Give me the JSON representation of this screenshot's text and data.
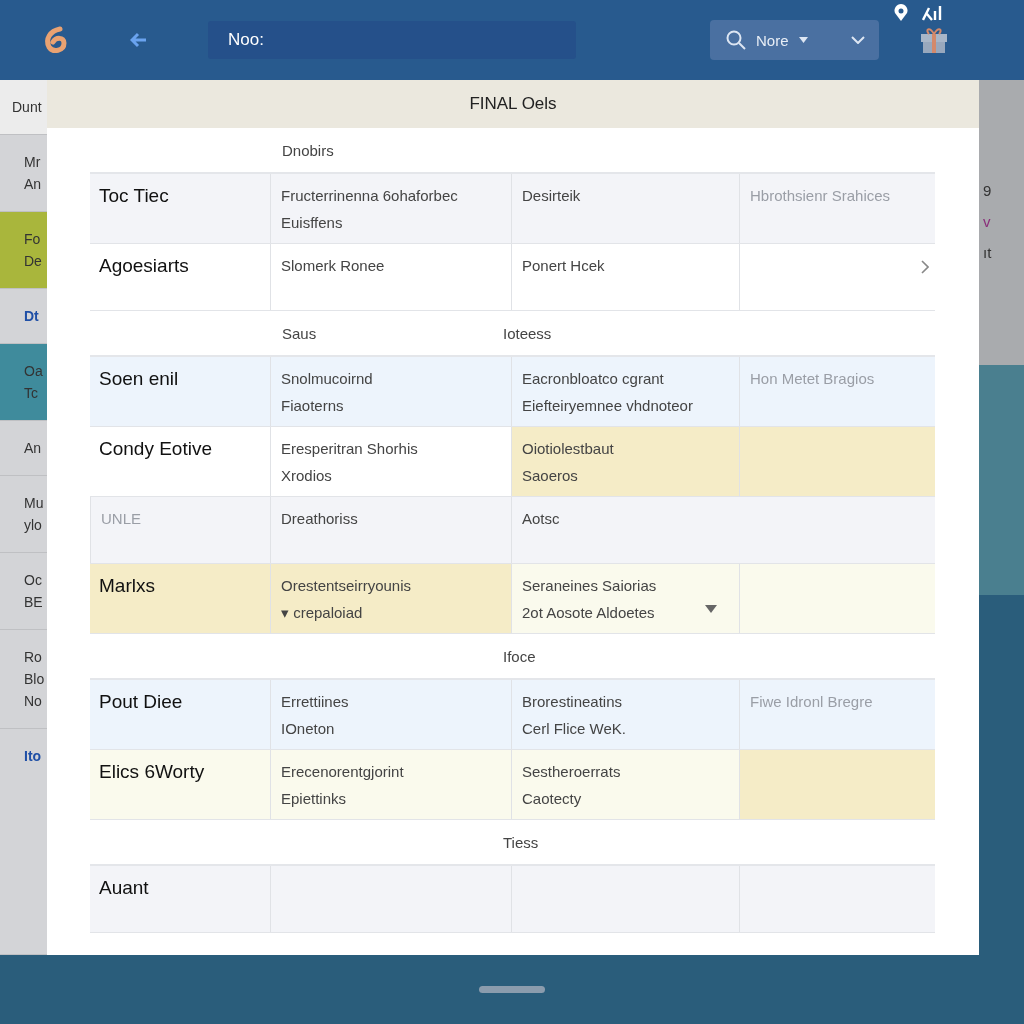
{
  "top_bar": {
    "field_value": "Noo:",
    "search": {
      "value": "Nore"
    }
  },
  "left_panel": [
    {
      "lines": [
        "Dunt"
      ],
      "kind": "header"
    },
    {
      "lines": [
        "Mr",
        "An"
      ],
      "kind": "plain"
    },
    {
      "lines": [
        "Fo",
        "De"
      ],
      "kind": "lime"
    },
    {
      "lines": [
        "Dt"
      ],
      "kind": "link"
    },
    {
      "lines": [
        "Oa",
        "Tc"
      ],
      "kind": "teal"
    },
    {
      "lines": [
        "An"
      ],
      "kind": "plain"
    },
    {
      "lines": [
        "Mu",
        "ylo"
      ],
      "kind": "plain"
    },
    {
      "lines": [
        "Oc",
        "BE"
      ],
      "kind": "plain"
    },
    {
      "lines": [
        "Ro",
        "Blo",
        "No"
      ],
      "kind": "plain"
    },
    {
      "lines": [
        "Ito"
      ],
      "kind": "link"
    }
  ],
  "right_panel": [
    {
      "text": "9",
      "kind": "plain"
    },
    {
      "text": "v",
      "kind": "accent"
    },
    {
      "text": "ıt",
      "kind": "plain"
    }
  ],
  "dialog": {
    "title": "FINAL Oels",
    "sections": [
      {
        "headings": [
          {
            "text": "Dnobirs",
            "kind": "second"
          }
        ],
        "rows": [
          {
            "cells": [
              {
                "kind": "title",
                "lines": [
                  "Toc Tiec"
                ],
                "color": "#f3f4f8",
                "muted": false
              },
              {
                "kind": "text",
                "lines": [
                  "Fructerrinenna 6ohaforbec",
                  "Euisffens"
                ],
                "color": "#f3f4f8",
                "muted": false
              },
              {
                "kind": "text",
                "lines": [
                  "Desirteik"
                ],
                "color": "#f3f4f8",
                "muted": false
              },
              {
                "kind": "text",
                "lines": [
                  "Hbrothsienr Srahices"
                ],
                "color": "#f3f4f8",
                "muted": true
              }
            ]
          },
          {
            "cells": [
              {
                "kind": "title",
                "lines": [
                  "Agoesiarts"
                ],
                "color": "#ffffff",
                "muted": false
              },
              {
                "kind": "text",
                "lines": [
                  "Slomerk Ronee"
                ],
                "color": "#ffffff",
                "muted": false
              },
              {
                "kind": "text",
                "lines": [
                  "Ponert Hcek"
                ],
                "color": "#ffffff",
                "muted": false
              },
              {
                "kind": "chevron",
                "color": "#ffffff"
              }
            ]
          }
        ]
      },
      {
        "headings": [
          {
            "text": "Saus",
            "kind": "second"
          },
          {
            "text": "Ioteess",
            "kind": "third"
          }
        ],
        "rows": [
          {
            "cells": [
              {
                "kind": "title",
                "lines": [
                  "Soen enil"
                ],
                "color": "#edf4fc",
                "muted": false
              },
              {
                "kind": "text",
                "lines": [
                  "Snolmucoirnd",
                  "Fiaoterns"
                ],
                "color": "#edf4fc",
                "muted": false
              },
              {
                "kind": "text",
                "lines": [
                  "Eacronbloatco cgrant",
                  "Eiefteiryemnee vhdnoteor"
                ],
                "color": "#edf4fc",
                "muted": false
              },
              {
                "kind": "text",
                "lines": [
                  "Hon Metet Bragios"
                ],
                "color": "#edf4fc",
                "muted": true
              }
            ]
          },
          {
            "cells": [
              {
                "kind": "title",
                "lines": [
                  "Condy Eotive"
                ],
                "color": "#ffffff",
                "muted": false
              },
              {
                "kind": "text",
                "lines": [
                  "Eresperitran Shorhis",
                  "Xrodios"
                ],
                "color": "#ffffff",
                "muted": false
              },
              {
                "kind": "text",
                "lines": [
                  "Oiotiolestbaut",
                  "Saoeros"
                ],
                "color": "#f5ecc7",
                "muted": false
              },
              {
                "kind": "empty",
                "color": "#f5ecc7"
              }
            ]
          },
          {
            "cells": [
              {
                "kind": "text",
                "lines": [
                  "UNLE"
                ],
                "color": "#f3f4f8",
                "muted": true
              },
              {
                "kind": "text",
                "lines": [
                  "Dreathoriss"
                ],
                "color": "#f3f4f8",
                "muted": false
              },
              {
                "kind": "wide",
                "lines": [
                  "Aotsc"
                ],
                "color": "#f3f4f8",
                "muted": false
              }
            ]
          },
          {
            "cells": [
              {
                "kind": "title",
                "lines": [
                  "Marlxs"
                ],
                "color": "#f5ecc7",
                "muted": false
              },
              {
                "kind": "text",
                "lines": [
                  "Orestentseirryounis",
                  "▾ crepaloiad"
                ],
                "color": "#f5ecc7",
                "muted": false
              },
              {
                "kind": "dropdown",
                "lines": [
                  "Seraneines Saiorias",
                  "2ot Aosote Aldoetes"
                ],
                "color": "#fafaed",
                "muted": false
              },
              {
                "kind": "empty",
                "color": "#fafaed"
              }
            ]
          }
        ]
      },
      {
        "headings": [
          {
            "text": "Ifoce",
            "kind": "third"
          }
        ],
        "rows": [
          {
            "cells": [
              {
                "kind": "title",
                "lines": [
                  "Pout Diee"
                ],
                "color": "#edf4fc",
                "muted": false
              },
              {
                "kind": "text",
                "lines": [
                  "Errettiines",
                  "IOneton"
                ],
                "color": "#edf4fc",
                "muted": false
              },
              {
                "kind": "text",
                "lines": [
                  "Brorestineatins",
                  "Cerl Flice WeK."
                ],
                "color": "#edf4fc",
                "muted": false
              },
              {
                "kind": "text",
                "lines": [
                  "Fiwe Idronl Bregre"
                ],
                "color": "#edf4fc",
                "muted": true
              }
            ]
          },
          {
            "cells": [
              {
                "kind": "title",
                "lines": [
                  "Elics 6Worty"
                ],
                "color": "#fafaed",
                "muted": false
              },
              {
                "kind": "text",
                "lines": [
                  "Erecenorentgjorint",
                  "Epiettinks"
                ],
                "color": "#fafaed",
                "muted": false
              },
              {
                "kind": "text",
                "lines": [
                  "Sestheroerrats",
                  "Caotecty"
                ],
                "color": "#fafaed",
                "muted": false
              },
              {
                "kind": "empty",
                "color": "#f5ecc7"
              }
            ]
          }
        ]
      },
      {
        "headings": [
          {
            "text": "Tiess",
            "kind": "third"
          }
        ],
        "rows": [
          {
            "cells": [
              {
                "kind": "title",
                "lines": [
                  "Auant"
                ],
                "color": "#f3f4f8",
                "muted": false
              },
              {
                "kind": "empty",
                "color": "#f3f4f8"
              },
              {
                "kind": "empty",
                "color": "#f3f4f8"
              },
              {
                "kind": "empty",
                "color": "#f3f4f8"
              }
            ]
          }
        ]
      }
    ]
  }
}
